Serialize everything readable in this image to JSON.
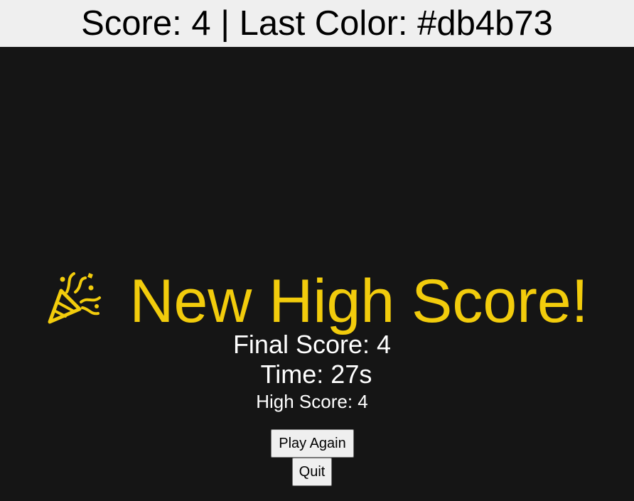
{
  "header": {
    "text": "Score: 4 | Last Color: #db4b73"
  },
  "result": {
    "headline": "New High Score!",
    "headline_icon": "party-popper-icon",
    "final_score": "Final Score: 4",
    "time": "Time: 27s",
    "high_score": "High Score: 4"
  },
  "actions": {
    "play_again_label": "Play Again",
    "quit_label": "Quit"
  },
  "colors": {
    "header_bg": "#efefef",
    "background": "#151515",
    "headline": "#f2cc0c",
    "stat_text": "#ffffff",
    "last_color": "#db4b73"
  }
}
